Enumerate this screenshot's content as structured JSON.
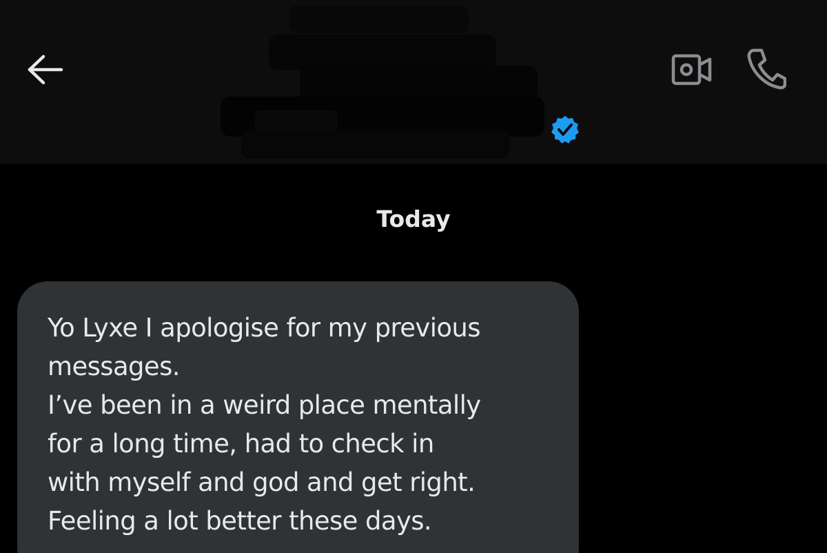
{
  "header": {
    "back_icon": "arrow-left-icon",
    "video_icon": "video-camera-icon",
    "call_icon": "phone-icon",
    "verified_icon": "verified-badge-icon",
    "verified_color": "#1d9bf0"
  },
  "conversation": {
    "date_separator": "Today",
    "messages": [
      {
        "lines": [
          "Yo Lyxe I apologise for my previous",
          "messages.",
          "I’ve been in a weird place mentally",
          "for a long time, had to check in",
          "with myself and god and get right.",
          "Feeling a lot better these days."
        ]
      }
    ]
  },
  "colors": {
    "background": "#000000",
    "bubble": "#2f3336",
    "text": "#e7e9ea",
    "icon": "#8b8d90"
  }
}
